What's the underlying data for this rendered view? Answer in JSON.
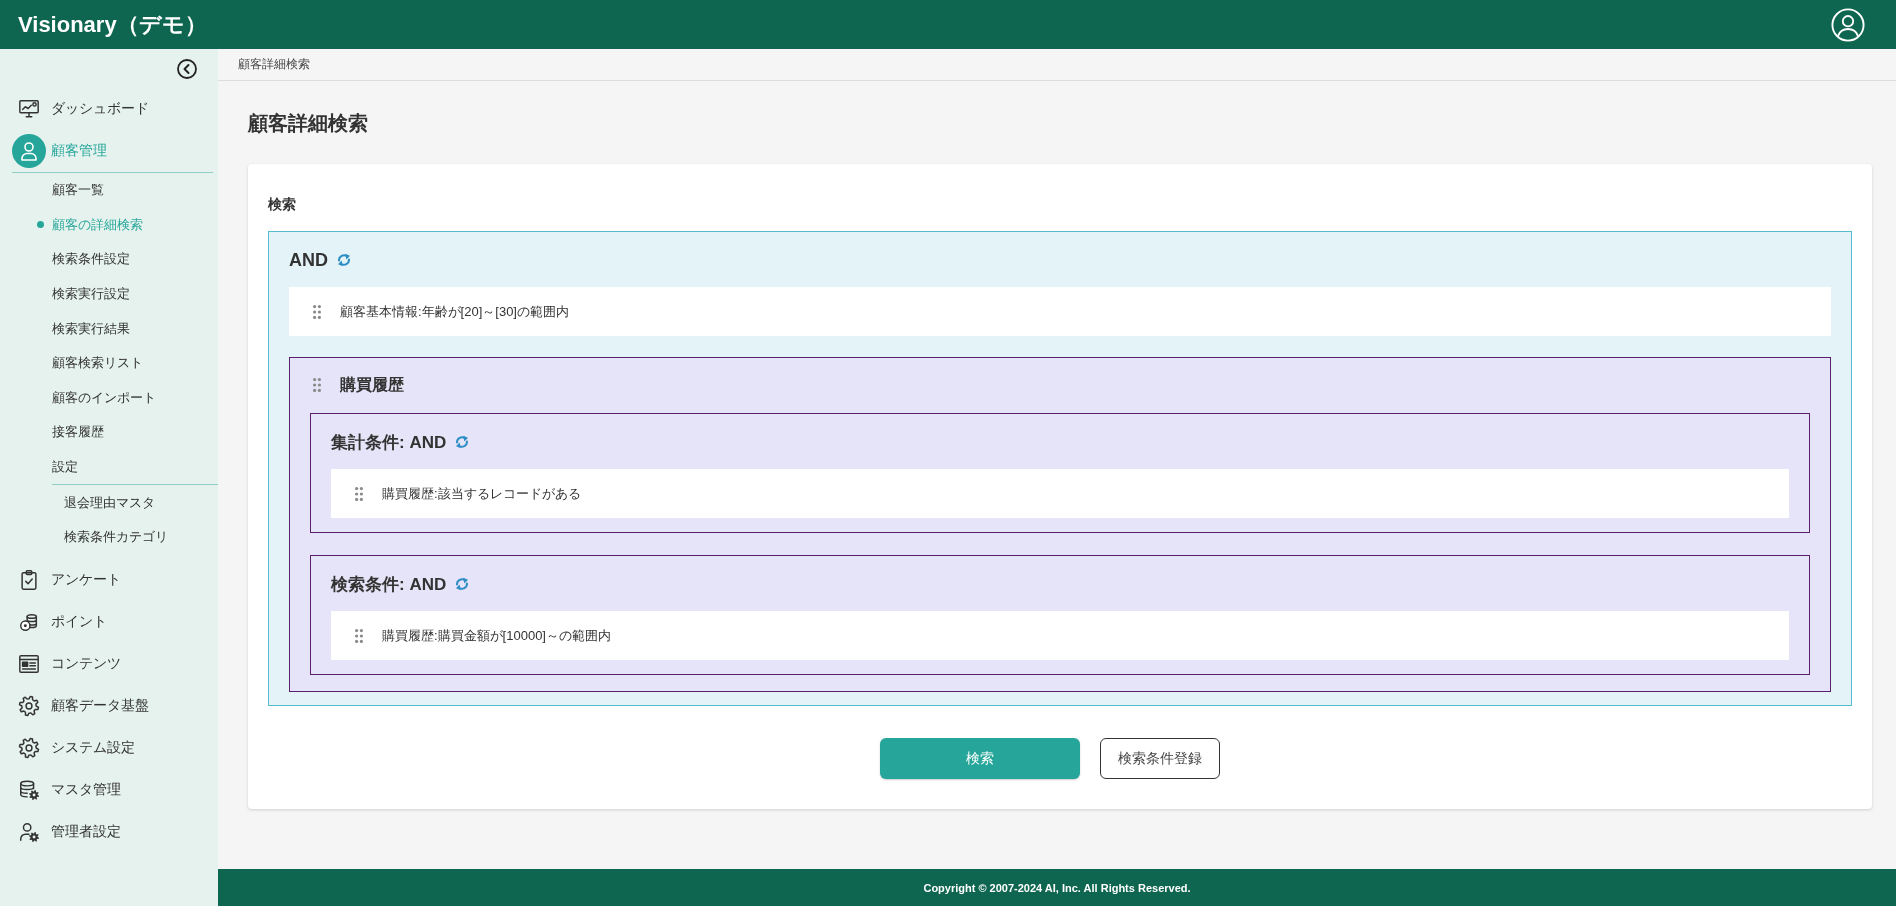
{
  "header": {
    "title": "Visionary（デモ）"
  },
  "sidebar": {
    "items": [
      {
        "label": "ダッシュボード",
        "selected": false
      },
      {
        "label": "顧客管理",
        "selected": true,
        "expanded": true,
        "children": [
          {
            "label": "顧客一覧",
            "selected": false
          },
          {
            "label": "顧客の詳細検索",
            "selected": true
          },
          {
            "label": "検索条件設定",
            "selected": false
          },
          {
            "label": "検索実行設定",
            "selected": false
          },
          {
            "label": "検索実行結果",
            "selected": false
          },
          {
            "label": "顧客検索リスト",
            "selected": false
          },
          {
            "label": "顧客のインポート",
            "selected": false
          },
          {
            "label": "接客履歴",
            "selected": false
          },
          {
            "label": "設定",
            "selected": false,
            "expanded": true,
            "children": [
              {
                "label": "退会理由マスタ",
                "selected": false
              },
              {
                "label": "検索条件カテゴリ",
                "selected": false
              }
            ]
          }
        ]
      },
      {
        "label": "アンケート",
        "selected": false
      },
      {
        "label": "ポイント",
        "selected": false
      },
      {
        "label": "コンテンツ",
        "selected": false
      },
      {
        "label": "顧客データ基盤",
        "selected": false
      },
      {
        "label": "システム設定",
        "selected": false
      },
      {
        "label": "マスタ管理",
        "selected": false
      },
      {
        "label": "管理者設定",
        "selected": false
      }
    ]
  },
  "breadcrumb": [
    "顧客詳細検索"
  ],
  "page_title": "顧客詳細検索",
  "search_panel": {
    "title": "検索",
    "root_group": {
      "operator": "AND",
      "children": [
        {
          "kind": "condition",
          "text": "顧客基本情報:年齢が[20]～[30]の範囲内"
        },
        {
          "kind": "group",
          "title": "購買履歴",
          "sections": [
            {
              "heading": "集計条件: AND",
              "conditions": [
                {
                  "text": "購買履歴:該当するレコードがある"
                }
              ]
            },
            {
              "heading": "検索条件: AND",
              "conditions": [
                {
                  "text": "購買履歴:購買金額が[10000]～の範囲内"
                }
              ]
            }
          ]
        }
      ]
    },
    "buttons": [
      {
        "label": "検索",
        "kind": "primary"
      },
      {
        "label": "検索条件登録",
        "kind": "secondary"
      }
    ]
  },
  "footer": {
    "copyright": "Copyright © 2007-2024 AI, Inc. All Rights Reserved."
  }
}
